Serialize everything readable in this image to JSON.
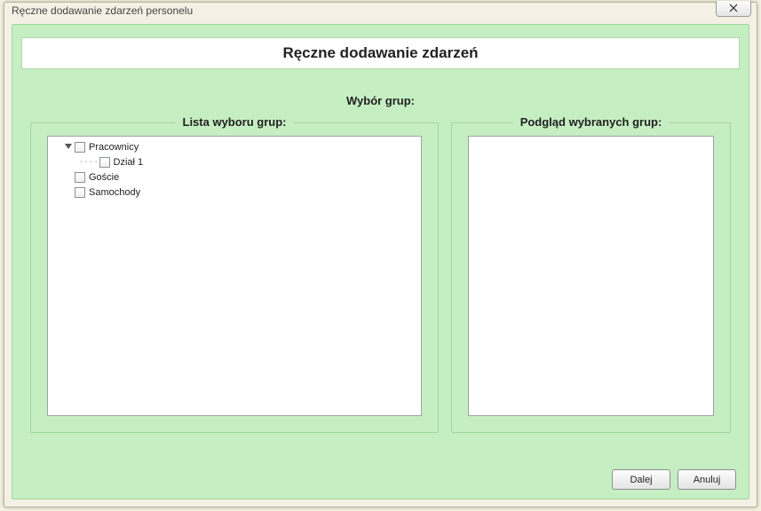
{
  "window": {
    "title": "Ręczne dodawanie zdarzeń personelu"
  },
  "panel": {
    "heading": "Ręczne dodawanie zdarzeń",
    "section_title": "Wybór grup:"
  },
  "left_group": {
    "label": "Lista wyboru grup:"
  },
  "right_group": {
    "label": "Podgląd wybranych grup:"
  },
  "tree": {
    "items": [
      {
        "label": "Pracownicy",
        "level": 1,
        "expanded": true,
        "has_children": true
      },
      {
        "label": "Dział 1",
        "level": 2,
        "expanded": false,
        "has_children": false
      },
      {
        "label": "Goście",
        "level": 1,
        "expanded": false,
        "has_children": false
      },
      {
        "label": "Samochody",
        "level": 1,
        "expanded": false,
        "has_children": false
      }
    ]
  },
  "buttons": {
    "next": "Dalej",
    "cancel": "Anuluj"
  }
}
